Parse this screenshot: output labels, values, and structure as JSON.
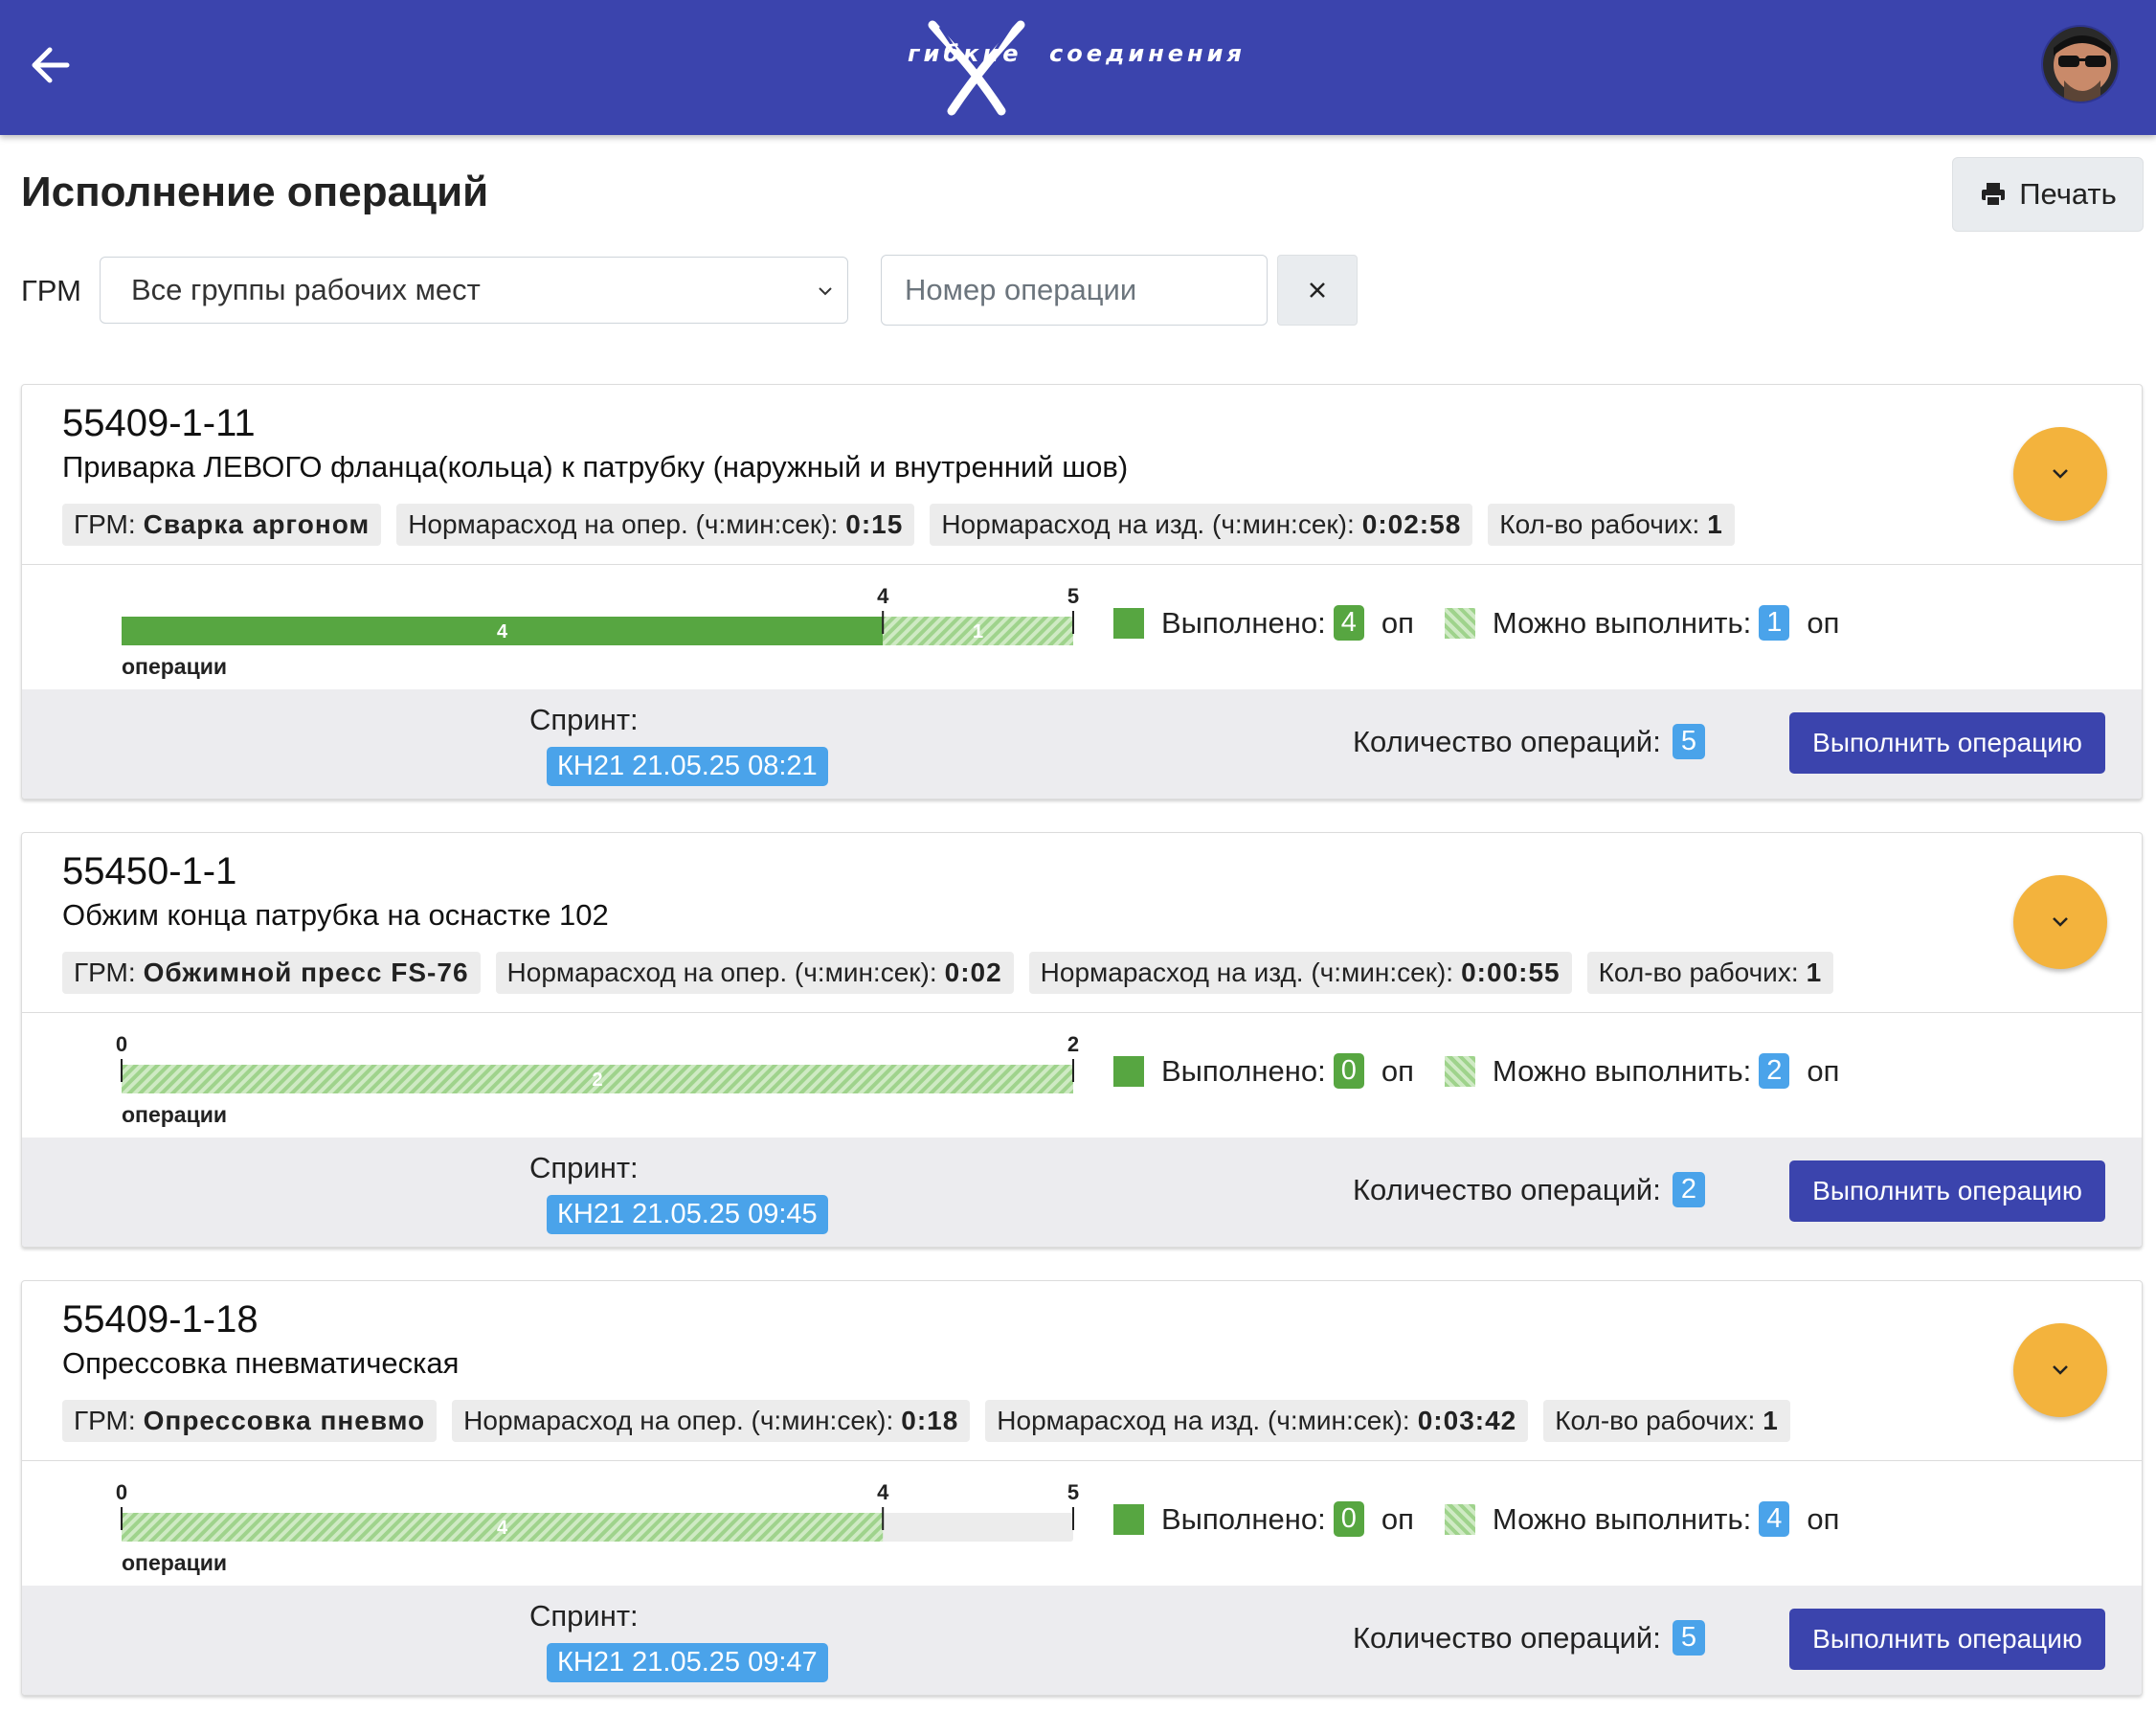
{
  "header": {
    "logo_left": "гибкие",
    "logo_right": "соединения",
    "colors": {
      "header_bg": "#3b44ad",
      "accent": "#f3b33d",
      "done": "#57a641",
      "badge": "#4aa3ea"
    }
  },
  "page": {
    "title": "Исполнение операций",
    "print_label": "Печать"
  },
  "filters": {
    "grm_label": "ГРМ",
    "grm_selected": "Все группы рабочих мест",
    "operation_placeholder": "Номер операции"
  },
  "labels": {
    "grm_prefix": "ГРМ:",
    "norm_op": "Нормарасход на опер. (ч:мин:сек):",
    "norm_item": "Нормарасход на изд. (ч:мин:сек):",
    "workers": "Кол-во рабочих:",
    "done": "Выполнено:",
    "can_do": "Можно выполнить:",
    "unit": "оп",
    "axis_label": "операции",
    "sprint": "Спринт:",
    "qty": "Количество операций:",
    "exec_button": "Выполнить операцию"
  },
  "cards": [
    {
      "code": "55409-1-11",
      "name": "Приварка ЛЕВОГО фланца(кольца) к патрубку (наружный и внутренний шов)",
      "grm": "Сварка аргоном",
      "norm_op": "0:15",
      "norm_item": "0:02:58",
      "workers": "1",
      "done": 4,
      "can_do": 1,
      "total": 5,
      "ticks": [
        "4",
        "5"
      ],
      "done_label": "4",
      "can_label": "1",
      "done_count": "4",
      "can_count": "1",
      "sprint": "КН21 21.05.25 08:21",
      "qty": "5"
    },
    {
      "code": "55450-1-1",
      "name": "Обжим конца патрубка на оснастке 102",
      "grm": "Обжимной пресс FS-76",
      "norm_op": "0:02",
      "norm_item": "0:00:55",
      "workers": "1",
      "done": 0,
      "can_do": 2,
      "total": 2,
      "ticks": [
        "0",
        "2"
      ],
      "done_label": "",
      "can_label": "2",
      "done_count": "0",
      "can_count": "2",
      "sprint": "КН21 21.05.25 09:45",
      "qty": "2"
    },
    {
      "code": "55409-1-18",
      "name": "Опрессовка пневматическая",
      "grm": "Опрессовка пневмо",
      "norm_op": "0:18",
      "norm_item": "0:03:42",
      "workers": "1",
      "done": 0,
      "can_do": 4,
      "total": 5,
      "ticks": [
        "0",
        "4",
        "5"
      ],
      "done_label": "",
      "can_label": "4",
      "done_count": "0",
      "can_count": "4",
      "sprint": "КН21 21.05.25 09:47",
      "qty": "5"
    }
  ]
}
